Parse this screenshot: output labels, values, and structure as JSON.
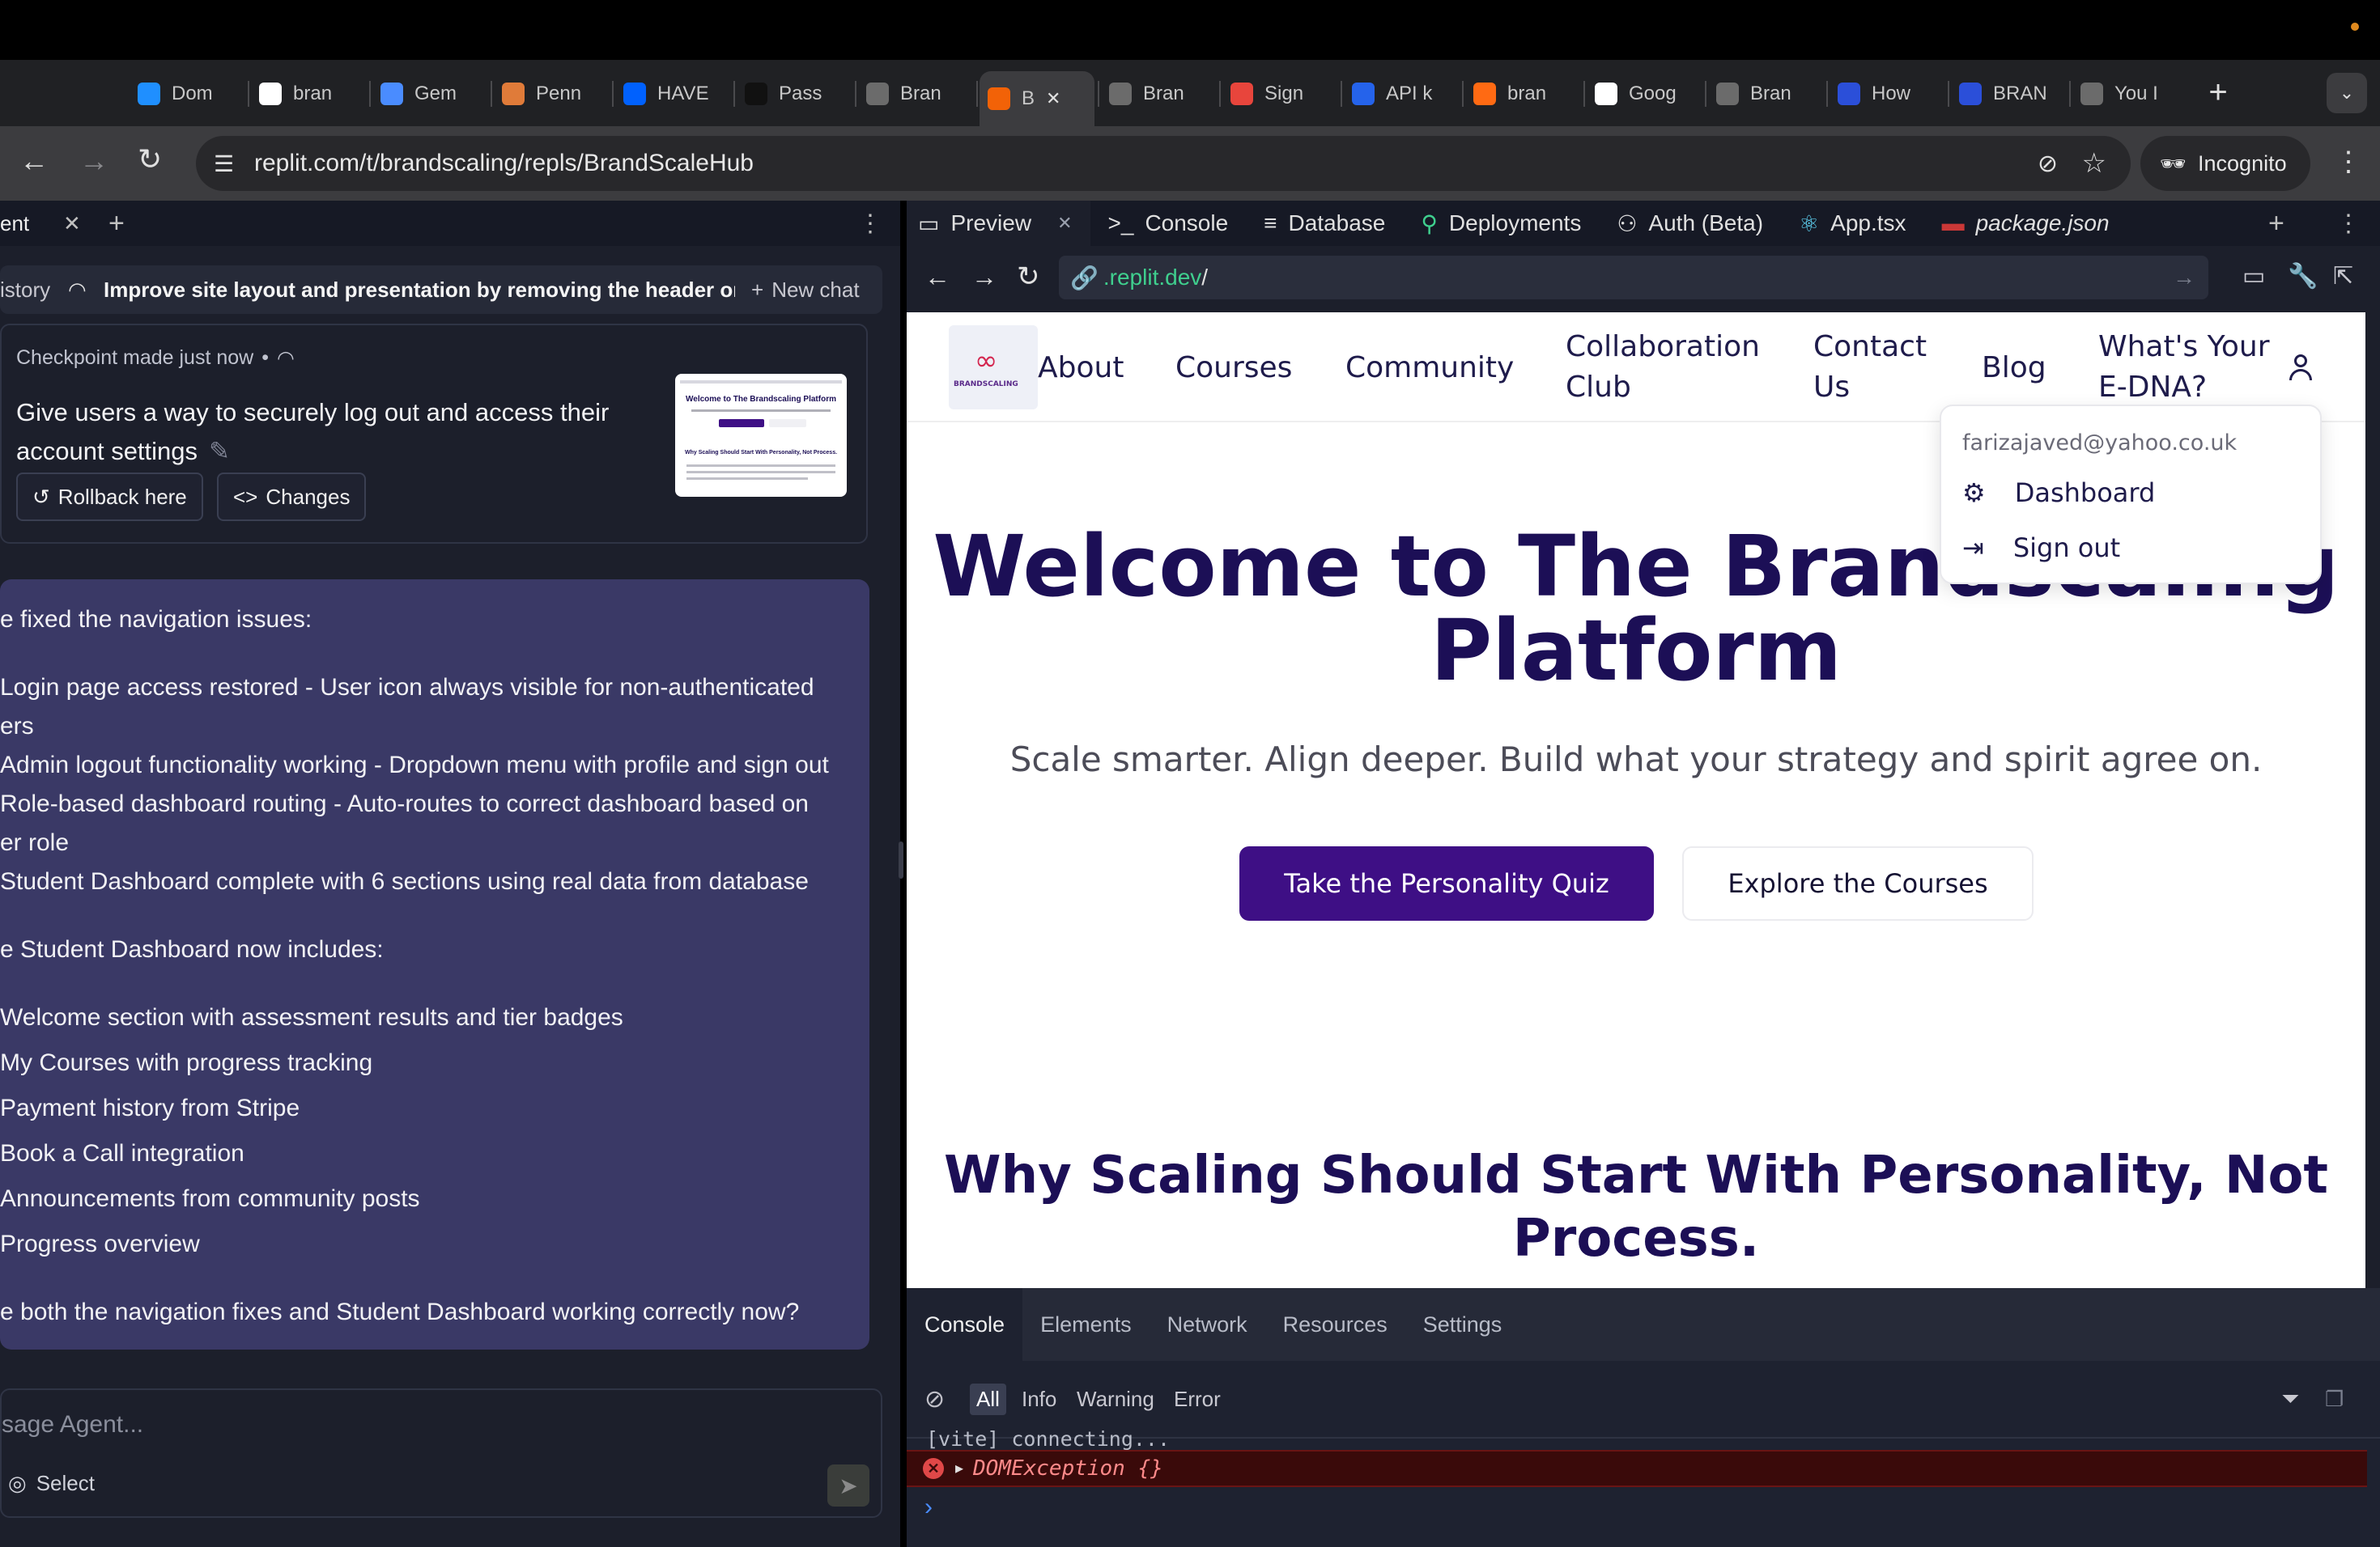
{
  "browser": {
    "tabs": [
      {
        "label": "Dom",
        "icon": "domain-icon",
        "color": "#1f8fff"
      },
      {
        "label": "bran",
        "icon": "brand-icon",
        "color": "#ffffff"
      },
      {
        "label": "Gem",
        "icon": "gemini-icon",
        "color": "#4a8cff"
      },
      {
        "label": "Penn",
        "icon": "penn-icon",
        "color": "#e07b39"
      },
      {
        "label": "HAVE",
        "icon": "dropbox-icon",
        "color": "#0061fe"
      },
      {
        "label": "Pass",
        "icon": "upwork-icon",
        "color": "#111111"
      },
      {
        "label": "Bran",
        "icon": "globe-icon",
        "color": "#6b6b6b"
      },
      {
        "label": "B",
        "icon": "replit-icon",
        "color": "#f26207",
        "active": true
      },
      {
        "label": "Bran",
        "icon": "globe-icon",
        "color": "#6b6b6b"
      },
      {
        "label": "Sign",
        "icon": "sign-icon",
        "color": "#e8453c"
      },
      {
        "label": "API k",
        "icon": "openai-icon",
        "color": "#2563eb"
      },
      {
        "label": "bran",
        "icon": "fire-icon",
        "color": "#ff6a13"
      },
      {
        "label": "Goog",
        "icon": "google-icon",
        "color": "#ffffff"
      },
      {
        "label": "Bran",
        "icon": "globe-icon",
        "color": "#6b6b6b"
      },
      {
        "label": "How",
        "icon": "arrow-icon",
        "color": "#2b4fd9"
      },
      {
        "label": "BRAN",
        "icon": "arrow-icon",
        "color": "#2b4fd9"
      },
      {
        "label": "You I",
        "icon": "globe-icon",
        "color": "#6b6b6b"
      }
    ],
    "url": "replit.com/t/brandscaling/repls/BrandScaleHub",
    "incognito_label": "Incognito"
  },
  "agent": {
    "tab_label": "ent",
    "history_label": "istory",
    "chat_title": "Improve site layout and presentation by removing the header on...",
    "new_chat_label": "New chat",
    "checkpoint": {
      "meta": "Checkpoint made just now",
      "title_line1": "Give users a way to securely log out and access their",
      "title_line2": "account settings",
      "rollback_label": "Rollback here",
      "changes_label": "Changes",
      "thumb_title": "Welcome to The Brandscaling Platform",
      "thumb_section": "Why Scaling Should Start With Personality, Not Process."
    },
    "message": {
      "lines": [
        "e fixed the navigation issues:",
        "Login page access restored - User icon always visible for non-authenticated",
        "ers",
        "Admin logout functionality working - Dropdown menu with profile and sign out",
        "Role-based dashboard routing - Auto-routes to correct dashboard based on",
        "er role",
        "Student Dashboard complete with 6 sections using real data from database",
        "e Student Dashboard now includes:",
        "Welcome section with assessment results and tier badges",
        "My Courses with progress tracking",
        "Payment history from Stripe",
        "Book a Call integration",
        "Announcements from community posts",
        "Progress overview",
        "e both the navigation fixes and Student Dashboard working correctly now?"
      ]
    },
    "input": {
      "placeholder": "sage Agent...",
      "select_label": "Select"
    }
  },
  "workspace": {
    "tabs": [
      {
        "label": "Preview",
        "icon": "monitor-icon"
      },
      {
        "label": "Console",
        "icon": "terminal-icon"
      },
      {
        "label": "Database",
        "icon": "database-icon"
      },
      {
        "label": "Deployments",
        "icon": "deploy-icon"
      },
      {
        "label": "Auth (Beta)",
        "icon": "user-check-icon"
      },
      {
        "label": "App.tsx",
        "icon": "react-icon"
      },
      {
        "label": "package.json",
        "icon": "npm-icon"
      }
    ],
    "preview_url_host": ".replit.dev",
    "preview_url_path": "/"
  },
  "site": {
    "logo_text": "BRANDSCALING",
    "nav": {
      "about": "About",
      "courses": "Courses",
      "community": "Community",
      "collab_1": "Collaboration",
      "collab_2": "Club",
      "contact_1": "Contact",
      "contact_2": "Us",
      "blog": "Blog",
      "edna_1": "What's Your",
      "edna_2": "E-DNA?"
    },
    "dropdown": {
      "email": "farizajaved@yahoo.co.uk",
      "dashboard": "Dashboard",
      "signout": "Sign out"
    },
    "hero_title_1": "Welcome to The Brandscaling",
    "hero_title_2": "Platform",
    "hero_sub": "Scale smarter. Align deeper. Build what your strategy and spirit agree on.",
    "cta_primary": "Take the Personality Quiz",
    "cta_secondary": "Explore the Courses",
    "why_title_1": "Why Scaling Should Start With Personality, Not",
    "why_title_2": "Process."
  },
  "devtools": {
    "tabs": [
      "Console",
      "Elements",
      "Network",
      "Resources",
      "Settings"
    ],
    "filters": [
      "All",
      "Info",
      "Warning",
      "Error"
    ],
    "log_line": "[vite] connecting...",
    "error_line": "DOMException {}"
  },
  "colors": {
    "brand_purple": "#3e0f85",
    "heading_navy": "#1c0f56",
    "agent_message_bg": "#3a3966",
    "error_bg": "#3a0a0a"
  }
}
